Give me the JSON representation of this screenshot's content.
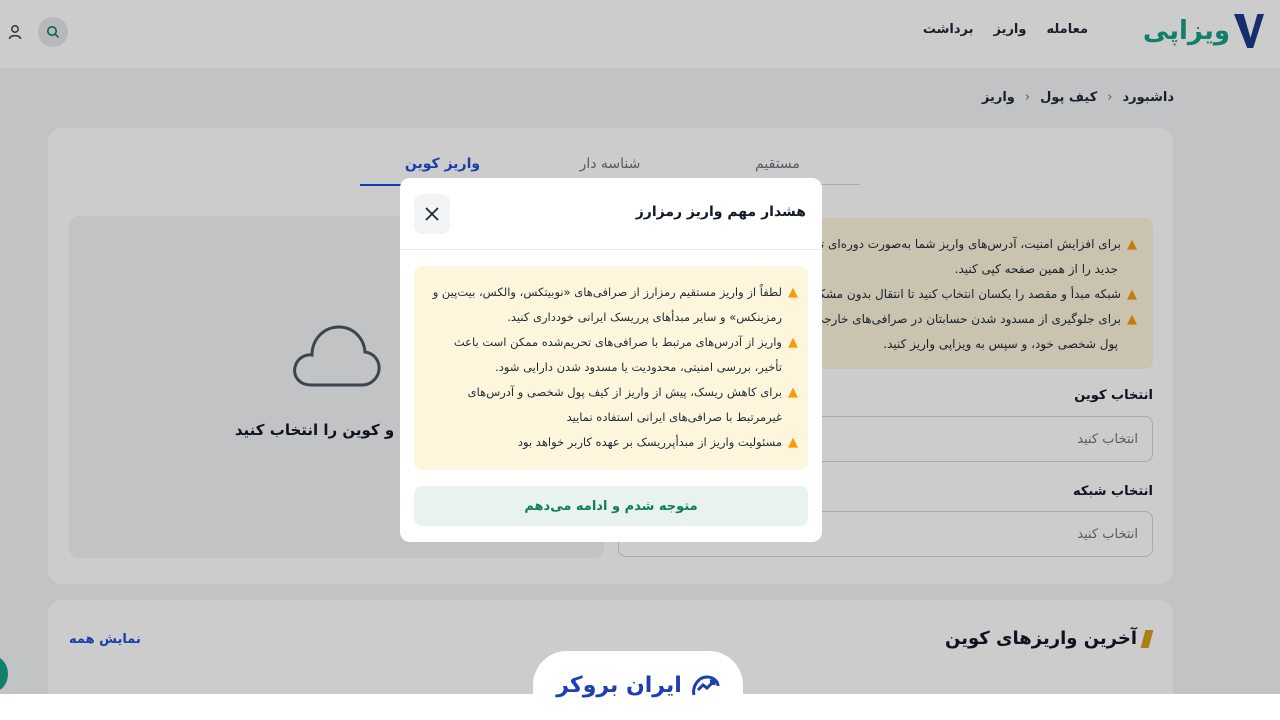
{
  "header": {
    "logo_text": "ویزاپی",
    "nav": [
      "معامله",
      "واریز",
      "برداشت"
    ]
  },
  "breadcrumb": [
    "داشبورد",
    "کیف پول",
    "واریز"
  ],
  "tabs": [
    "مستقیم",
    "شناسه دار",
    "واریز کوین"
  ],
  "active_tab": "واریز کوین",
  "upload": {
    "text": "شبکه و کوین را انتخاب کنید"
  },
  "info_warnings": [
    "برای افزایش امنیت، آدرس‌های واریز شما به‌صورت دوره‌ای تغییر",
    "جدید را از همین صفحه کپی کنید.",
    "شبکه مبدأ و مقصد را یکسان انتخاب کنید تا انتقال بدون مشکل",
    "برای جلوگیری از مسدود شدن حسابتان در صرافی‌های خارجی (م",
    "پول شخصی خود، و سپس به ویزاپی واریز کنید."
  ],
  "fields": {
    "coin_label": "انتخاب کوین",
    "coin_placeholder": "انتخاب کنید",
    "network_label": "انتخاب شبکه",
    "network_placeholder": "انتخاب کنید"
  },
  "recent": {
    "title": "آخرین واریزهای کوین",
    "show_all": "نمایش همه"
  },
  "modal": {
    "title": "هشدار مهم واریز رمزارز",
    "warnings": [
      "لطفاً از واریز مستقیم رمزارز از صرافی‌های «نوبیتکس، والکس، بیت‌پین و رمزینکس» و سایر مبدأهای پرریسک ایرانی خودداری کنید.",
      "واریز از آدرس‌های مرتبط با صرافی‌های تحریم‌شده ممکن است باعث تأخیر، بررسی امنیتی، محدودیت یا مسدود شدن دارایی شود.",
      "برای کاهش ریسک، پیش از واریز از کیف پول شخصی و آدرس‌های غیرمرتبط با صرافی‌های ایرانی استفاده نمایید",
      "مسئولیت واریز از مبدأپرریسک بر عهده کاربر خواهد بود"
    ],
    "confirm": "متوجه شدم و ادامه می‌دهم"
  },
  "watermark": {
    "text": "ایران بروکر"
  },
  "colors": {
    "brand_blue": "#1b3a8a",
    "brand_green": "#16a085",
    "link_blue": "#1d4ed8",
    "warning_bg": "#fdf4dc",
    "warning_icon": "#f59e0b",
    "confirm_text": "#0f7b5f"
  }
}
